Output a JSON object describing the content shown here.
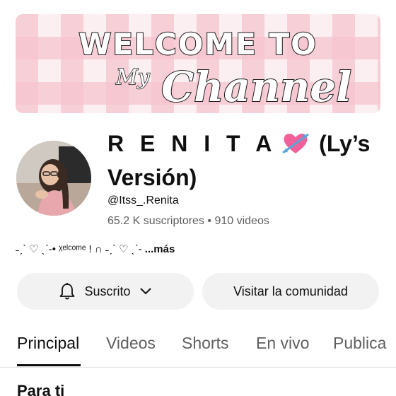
{
  "banner": {
    "line1": "WELCOME TO",
    "line2": "My",
    "line3": "Channel"
  },
  "channel": {
    "name_part1": "R E N I T A",
    "name_part2": "(Ly’s",
    "name_part3": "Versión)",
    "handle": "@Itss_.Renita",
    "stats": "65.2 K suscriptores • 910 videos",
    "description": "˗ˏˋ ♡ ˎˊ-• ᵡᵉˡᶜᵒᵐᵉ ! ∩ ˗ˏˋ ♡ ˎˊ-",
    "more_label": "...más"
  },
  "icons": {
    "heart": "heart-with-arrow-icon",
    "bell": "bell-icon",
    "chevron": "chevron-down-icon"
  },
  "buttons": {
    "subscribed_label": "Suscrito",
    "community_label": "Visitar la comunidad"
  },
  "tabs": [
    "Principal",
    "Videos",
    "Shorts",
    "En vivo",
    "Publica"
  ],
  "section": {
    "title": "Para ti"
  },
  "colors": {
    "text": "#0f0f0f",
    "secondary": "#606060",
    "button_bg": "#f2f2f2",
    "banner_pink": "#f6c4ce"
  }
}
